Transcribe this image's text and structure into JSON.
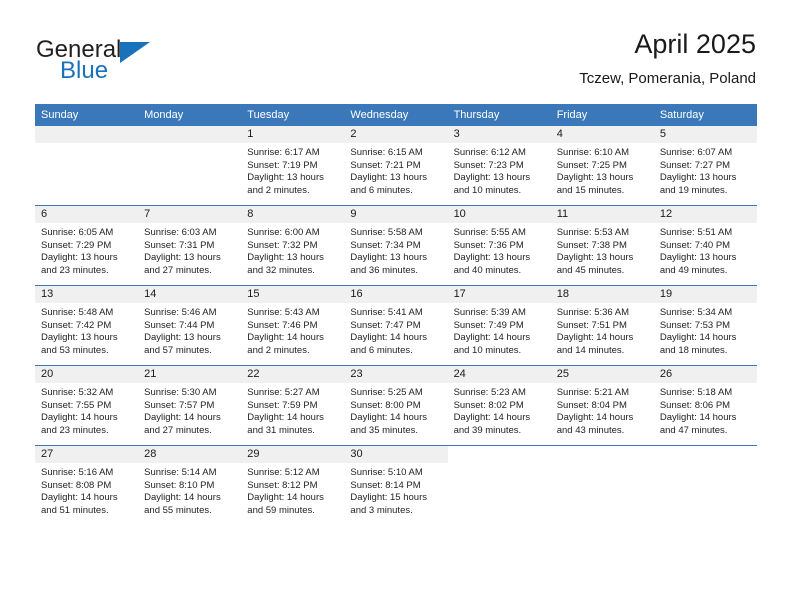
{
  "brand": {
    "word1": "General",
    "word2": "Blue",
    "accent_color": "#1a72bb",
    "logo_icon": "triangle-flag-icon"
  },
  "header": {
    "title": "April 2025",
    "subtitle": "Tczew, Pomerania, Poland"
  },
  "theme": {
    "header_blue": "#3b78b9",
    "band_gray": "#f0f0f0",
    "text": "#1a1a1a"
  },
  "weekday_headers": [
    "Sunday",
    "Monday",
    "Tuesday",
    "Wednesday",
    "Thursday",
    "Friday",
    "Saturday"
  ],
  "weeks": [
    [
      {
        "blank": true
      },
      {
        "blank": true
      },
      {
        "day": "1",
        "sunrise": "Sunrise: 6:17 AM",
        "sunset": "Sunset: 7:19 PM",
        "daylight_line1": "Daylight: 13 hours",
        "daylight_line2": "and 2 minutes."
      },
      {
        "day": "2",
        "sunrise": "Sunrise: 6:15 AM",
        "sunset": "Sunset: 7:21 PM",
        "daylight_line1": "Daylight: 13 hours",
        "daylight_line2": "and 6 minutes."
      },
      {
        "day": "3",
        "sunrise": "Sunrise: 6:12 AM",
        "sunset": "Sunset: 7:23 PM",
        "daylight_line1": "Daylight: 13 hours",
        "daylight_line2": "and 10 minutes."
      },
      {
        "day": "4",
        "sunrise": "Sunrise: 6:10 AM",
        "sunset": "Sunset: 7:25 PM",
        "daylight_line1": "Daylight: 13 hours",
        "daylight_line2": "and 15 minutes."
      },
      {
        "day": "5",
        "sunrise": "Sunrise: 6:07 AM",
        "sunset": "Sunset: 7:27 PM",
        "daylight_line1": "Daylight: 13 hours",
        "daylight_line2": "and 19 minutes."
      }
    ],
    [
      {
        "day": "6",
        "sunrise": "Sunrise: 6:05 AM",
        "sunset": "Sunset: 7:29 PM",
        "daylight_line1": "Daylight: 13 hours",
        "daylight_line2": "and 23 minutes."
      },
      {
        "day": "7",
        "sunrise": "Sunrise: 6:03 AM",
        "sunset": "Sunset: 7:31 PM",
        "daylight_line1": "Daylight: 13 hours",
        "daylight_line2": "and 27 minutes."
      },
      {
        "day": "8",
        "sunrise": "Sunrise: 6:00 AM",
        "sunset": "Sunset: 7:32 PM",
        "daylight_line1": "Daylight: 13 hours",
        "daylight_line2": "and 32 minutes."
      },
      {
        "day": "9",
        "sunrise": "Sunrise: 5:58 AM",
        "sunset": "Sunset: 7:34 PM",
        "daylight_line1": "Daylight: 13 hours",
        "daylight_line2": "and 36 minutes."
      },
      {
        "day": "10",
        "sunrise": "Sunrise: 5:55 AM",
        "sunset": "Sunset: 7:36 PM",
        "daylight_line1": "Daylight: 13 hours",
        "daylight_line2": "and 40 minutes."
      },
      {
        "day": "11",
        "sunrise": "Sunrise: 5:53 AM",
        "sunset": "Sunset: 7:38 PM",
        "daylight_line1": "Daylight: 13 hours",
        "daylight_line2": "and 45 minutes."
      },
      {
        "day": "12",
        "sunrise": "Sunrise: 5:51 AM",
        "sunset": "Sunset: 7:40 PM",
        "daylight_line1": "Daylight: 13 hours",
        "daylight_line2": "and 49 minutes."
      }
    ],
    [
      {
        "day": "13",
        "sunrise": "Sunrise: 5:48 AM",
        "sunset": "Sunset: 7:42 PM",
        "daylight_line1": "Daylight: 13 hours",
        "daylight_line2": "and 53 minutes."
      },
      {
        "day": "14",
        "sunrise": "Sunrise: 5:46 AM",
        "sunset": "Sunset: 7:44 PM",
        "daylight_line1": "Daylight: 13 hours",
        "daylight_line2": "and 57 minutes."
      },
      {
        "day": "15",
        "sunrise": "Sunrise: 5:43 AM",
        "sunset": "Sunset: 7:46 PM",
        "daylight_line1": "Daylight: 14 hours",
        "daylight_line2": "and 2 minutes."
      },
      {
        "day": "16",
        "sunrise": "Sunrise: 5:41 AM",
        "sunset": "Sunset: 7:47 PM",
        "daylight_line1": "Daylight: 14 hours",
        "daylight_line2": "and 6 minutes."
      },
      {
        "day": "17",
        "sunrise": "Sunrise: 5:39 AM",
        "sunset": "Sunset: 7:49 PM",
        "daylight_line1": "Daylight: 14 hours",
        "daylight_line2": "and 10 minutes."
      },
      {
        "day": "18",
        "sunrise": "Sunrise: 5:36 AM",
        "sunset": "Sunset: 7:51 PM",
        "daylight_line1": "Daylight: 14 hours",
        "daylight_line2": "and 14 minutes."
      },
      {
        "day": "19",
        "sunrise": "Sunrise: 5:34 AM",
        "sunset": "Sunset: 7:53 PM",
        "daylight_line1": "Daylight: 14 hours",
        "daylight_line2": "and 18 minutes."
      }
    ],
    [
      {
        "day": "20",
        "sunrise": "Sunrise: 5:32 AM",
        "sunset": "Sunset: 7:55 PM",
        "daylight_line1": "Daylight: 14 hours",
        "daylight_line2": "and 23 minutes."
      },
      {
        "day": "21",
        "sunrise": "Sunrise: 5:30 AM",
        "sunset": "Sunset: 7:57 PM",
        "daylight_line1": "Daylight: 14 hours",
        "daylight_line2": "and 27 minutes."
      },
      {
        "day": "22",
        "sunrise": "Sunrise: 5:27 AM",
        "sunset": "Sunset: 7:59 PM",
        "daylight_line1": "Daylight: 14 hours",
        "daylight_line2": "and 31 minutes."
      },
      {
        "day": "23",
        "sunrise": "Sunrise: 5:25 AM",
        "sunset": "Sunset: 8:00 PM",
        "daylight_line1": "Daylight: 14 hours",
        "daylight_line2": "and 35 minutes."
      },
      {
        "day": "24",
        "sunrise": "Sunrise: 5:23 AM",
        "sunset": "Sunset: 8:02 PM",
        "daylight_line1": "Daylight: 14 hours",
        "daylight_line2": "and 39 minutes."
      },
      {
        "day": "25",
        "sunrise": "Sunrise: 5:21 AM",
        "sunset": "Sunset: 8:04 PM",
        "daylight_line1": "Daylight: 14 hours",
        "daylight_line2": "and 43 minutes."
      },
      {
        "day": "26",
        "sunrise": "Sunrise: 5:18 AM",
        "sunset": "Sunset: 8:06 PM",
        "daylight_line1": "Daylight: 14 hours",
        "daylight_line2": "and 47 minutes."
      }
    ],
    [
      {
        "day": "27",
        "sunrise": "Sunrise: 5:16 AM",
        "sunset": "Sunset: 8:08 PM",
        "daylight_line1": "Daylight: 14 hours",
        "daylight_line2": "and 51 minutes."
      },
      {
        "day": "28",
        "sunrise": "Sunrise: 5:14 AM",
        "sunset": "Sunset: 8:10 PM",
        "daylight_line1": "Daylight: 14 hours",
        "daylight_line2": "and 55 minutes."
      },
      {
        "day": "29",
        "sunrise": "Sunrise: 5:12 AM",
        "sunset": "Sunset: 8:12 PM",
        "daylight_line1": "Daylight: 14 hours",
        "daylight_line2": "and 59 minutes."
      },
      {
        "day": "30",
        "sunrise": "Sunrise: 5:10 AM",
        "sunset": "Sunset: 8:14 PM",
        "daylight_line1": "Daylight: 15 hours",
        "daylight_line2": "and 3 minutes."
      },
      {
        "trailing": true
      },
      {
        "trailing": true
      },
      {
        "trailing": true
      }
    ]
  ]
}
